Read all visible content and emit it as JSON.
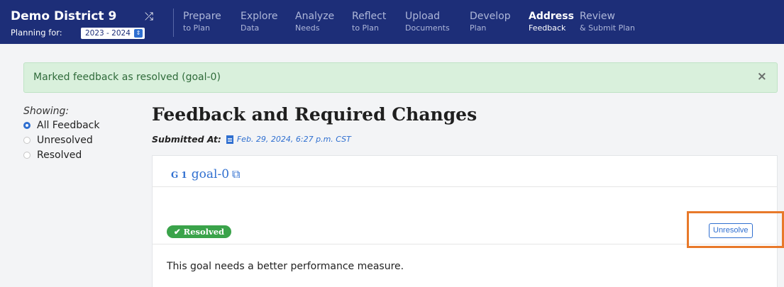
{
  "header": {
    "district": "Demo District 9",
    "planning_label": "Planning for:",
    "year": "2023 - 2024",
    "nav": [
      {
        "main": "Prepare",
        "sub": "to Plan"
      },
      {
        "main": "Explore",
        "sub": "Data"
      },
      {
        "main": "Analyze",
        "sub": "Needs"
      },
      {
        "main": "Reflect",
        "sub": "to Plan"
      },
      {
        "main": "Upload",
        "sub": "Documents"
      },
      {
        "main": "Develop",
        "sub": "Plan"
      },
      {
        "main": "Address",
        "sub": "Feedback"
      },
      {
        "main": "Review",
        "sub": "& Submit Plan"
      }
    ],
    "active_index": 6
  },
  "alert": {
    "text": "Marked feedback as resolved (goal-0)",
    "close": "×"
  },
  "filters": {
    "label": "Showing:",
    "options": [
      "All Feedback",
      "Unresolved",
      "Resolved"
    ],
    "selected": "All Feedback"
  },
  "main": {
    "title": "Feedback and Required Changes",
    "submitted_label": "Submitted At:",
    "submitted_date": "Feb. 29, 2024, 6:27 p.m. CST"
  },
  "goal": {
    "code": "G 1",
    "name": "goal-0",
    "status": "✔ Resolved",
    "unresolve_label": "Unresolve",
    "feedback": "This goal needs a better performance measure."
  },
  "colors": {
    "nav_bg": "#1d2e78",
    "accent": "#2f6fd0",
    "success": "#3aa34a",
    "alert_bg": "#d9f0dc",
    "highlight": "#e8792a"
  }
}
